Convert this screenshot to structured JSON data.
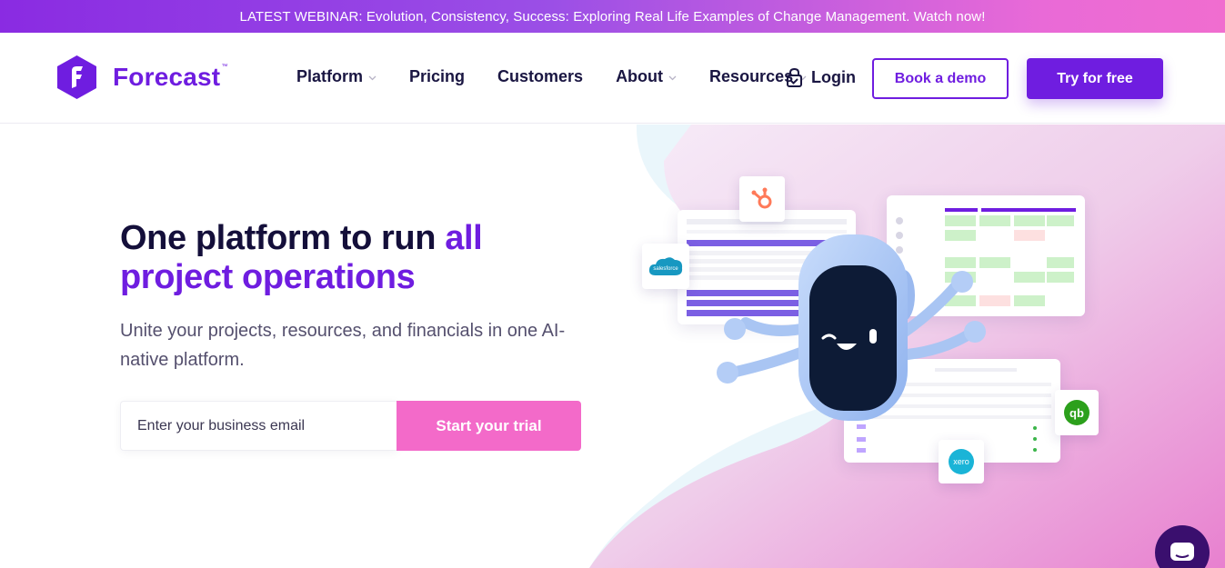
{
  "banner": {
    "text": "LATEST WEBINAR: Evolution, Consistency, Success: Exploring Real Life Examples of Change Management. Watch now!"
  },
  "header": {
    "logo_text": "Forecast",
    "logo_tm": "™",
    "nav": [
      {
        "label": "Platform",
        "has_dropdown": true
      },
      {
        "label": "Pricing",
        "has_dropdown": false
      },
      {
        "label": "Customers",
        "has_dropdown": false
      },
      {
        "label": "About",
        "has_dropdown": true
      },
      {
        "label": "Resources",
        "has_dropdown": true
      }
    ],
    "login_label": "Login",
    "demo_label": "Book a demo",
    "try_label": "Try for free"
  },
  "hero": {
    "headline_part1": "One platform to run ",
    "headline_accent1": "all",
    "headline_accent2": "project operations",
    "subheadline": "Unite your projects, resources, and financials in one AI-native platform.",
    "email_placeholder": "Enter your business email",
    "cta_label": "Start your trial"
  },
  "illustration": {
    "integrations": [
      {
        "name": "hubspot-icon",
        "label": ""
      },
      {
        "name": "salesforce-icon",
        "label": "salesforce"
      },
      {
        "name": "quickbooks-icon",
        "label": "qb"
      },
      {
        "name": "xero-icon",
        "label": "xero"
      }
    ]
  },
  "colors": {
    "brand_purple": "#6f1de0",
    "cta_pink": "#f36ac9",
    "heading": "#140f3a",
    "chat_bubble": "#3a0f6e"
  }
}
